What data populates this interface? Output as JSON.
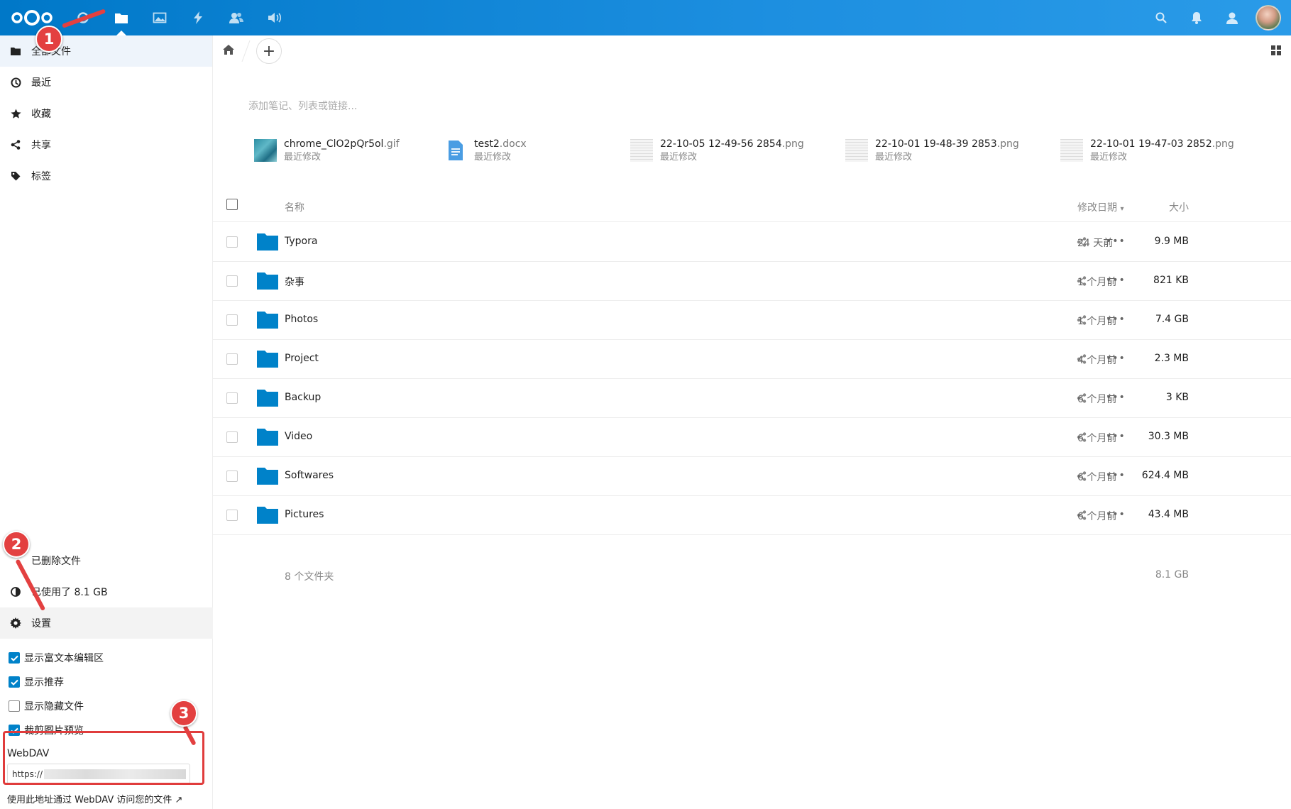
{
  "header": {
    "apps": [
      "dashboard",
      "files",
      "photos",
      "activity",
      "contacts",
      "talk"
    ],
    "active_app": "files",
    "accent": "#0082c9"
  },
  "sidebar": {
    "items": [
      {
        "label": "全部文件",
        "icon": "folder-icon"
      },
      {
        "label": "最近",
        "icon": "clock-icon"
      },
      {
        "label": "收藏",
        "icon": "star-icon"
      },
      {
        "label": "共享",
        "icon": "share-icon"
      },
      {
        "label": "标签",
        "icon": "tag-icon"
      }
    ],
    "deleted": "已删除文件",
    "quota": "已使用了 8.1 GB",
    "settings": "设置",
    "options": [
      {
        "label": "显示富文本编辑区",
        "checked": true
      },
      {
        "label": "显示推荐",
        "checked": true
      },
      {
        "label": "显示隐藏文件",
        "checked": false
      },
      {
        "label": "裁剪图片预览",
        "checked": true
      }
    ],
    "webdav_label": "WebDAV",
    "webdav_url": "https://",
    "webdav_hint": "使用此地址通过 WebDAV 访问您的文件 ↗"
  },
  "annotations": [
    "1",
    "2",
    "3"
  ],
  "main": {
    "rich_placeholder": "添加笔记、列表或链接...",
    "recent": [
      {
        "name": "chrome_ClO2pQr5ol",
        "ext": ".gif",
        "sub": "最近修改"
      },
      {
        "name": "test2",
        "ext": ".docx",
        "sub": "最近修改"
      },
      {
        "name": "22-10-05 12-49-56 2854",
        "ext": ".png",
        "sub": "最近修改"
      },
      {
        "name": "22-10-01 19-48-39 2853",
        "ext": ".png",
        "sub": "最近修改"
      },
      {
        "name": "22-10-01 19-47-03 2852",
        "ext": ".png",
        "sub": "最近修改"
      }
    ],
    "columns": {
      "name": "名称",
      "size": "大小",
      "modified": "修改日期"
    },
    "files": [
      {
        "name": "Typora",
        "size": "9.9 MB",
        "modified": "24 天前"
      },
      {
        "name": "杂事",
        "size": "821 KB",
        "modified": "1 个月前"
      },
      {
        "name": "Photos",
        "size": "7.4 GB",
        "modified": "1 个月前"
      },
      {
        "name": "Project",
        "size": "2.3 MB",
        "modified": "4 个月前"
      },
      {
        "name": "Backup",
        "size": "3 KB",
        "modified": "6 个月前"
      },
      {
        "name": "Video",
        "size": "30.3 MB",
        "modified": "6 个月前"
      },
      {
        "name": "Softwares",
        "size": "624.4 MB",
        "modified": "6 个月前"
      },
      {
        "name": "Pictures",
        "size": "43.4 MB",
        "modified": "6 个月前"
      }
    ],
    "summary": {
      "count": "8 个文件夹",
      "total": "8.1 GB"
    }
  }
}
